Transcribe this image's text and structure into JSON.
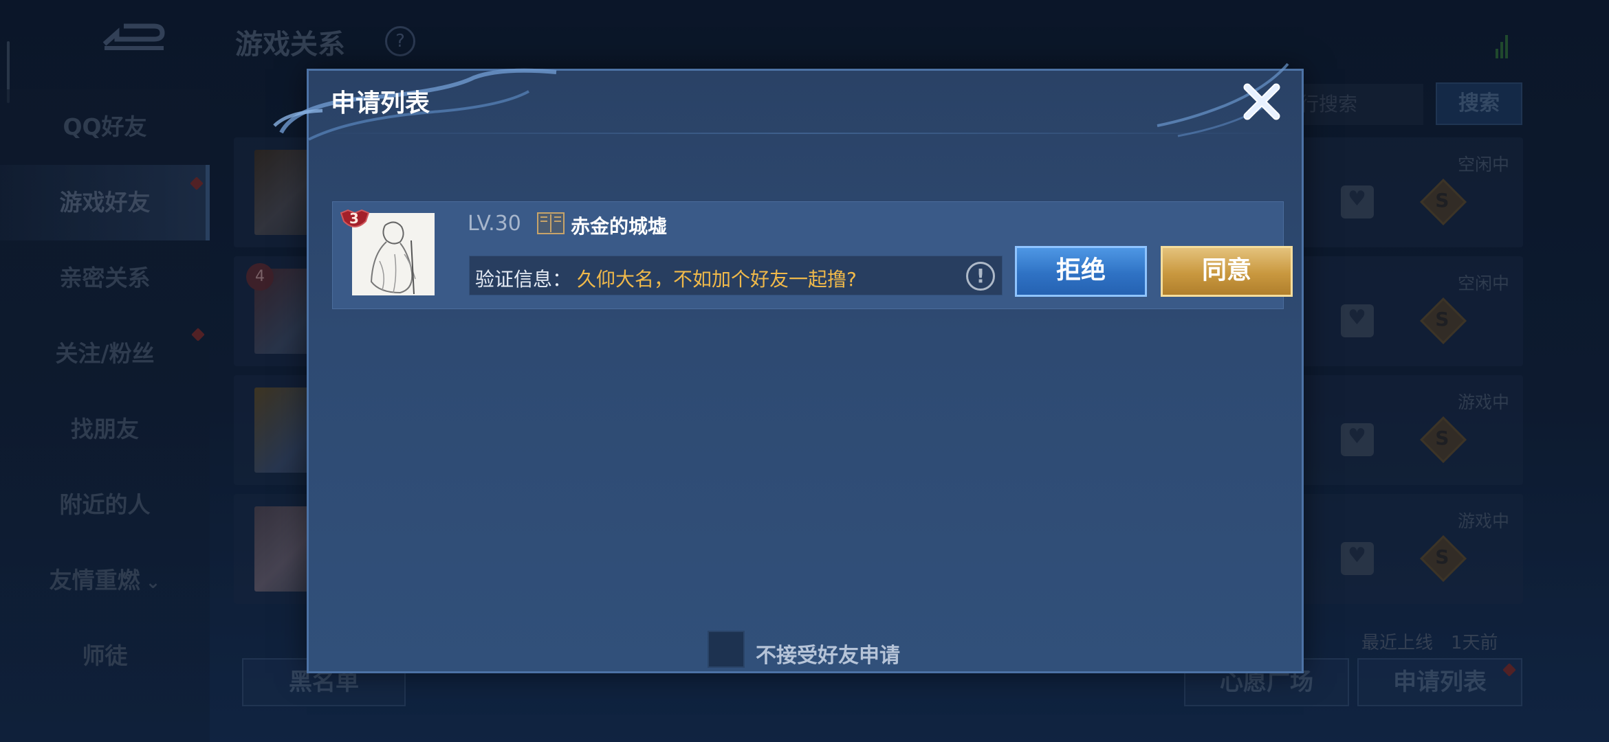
{
  "background": {
    "title": "游戏关系",
    "help_glyph": "?",
    "sidebar": {
      "items": [
        {
          "label": "QQ好友"
        },
        {
          "label": "游戏好友"
        },
        {
          "label": "亲密关系"
        },
        {
          "label": "关注/粉丝"
        },
        {
          "label": "找朋友"
        },
        {
          "label": "附近的人"
        },
        {
          "label": "友情重燃"
        },
        {
          "label": "师徒"
        }
      ],
      "expand_glyph": "⌄"
    },
    "search": {
      "placeholder_partial": "行搜索",
      "button_label": "搜索"
    },
    "friend_rows": [
      {
        "status": "空闲中",
        "level": ""
      },
      {
        "status": "空闲中",
        "level": "4"
      },
      {
        "status": "游戏中",
        "level": ""
      },
      {
        "status": "游戏中",
        "level": ""
      }
    ],
    "diamond_glyph": "S",
    "last_online": "最近上线　1天前",
    "bottom_buttons": {
      "blacklist": "黑名单",
      "wish_square": "心愿广场",
      "request_list": "申请列表"
    }
  },
  "dialog": {
    "title": "申请列表",
    "requests": [
      {
        "rank_badge": "3",
        "level": "LV.30",
        "name": "赤金的城墟",
        "verify_label": "验证信息：",
        "verify_message": "久仰大名，不如加个好友一起撸?",
        "info_glyph": "!",
        "reject_label": "拒绝",
        "accept_label": "同意"
      }
    ],
    "no_requests_checkbox_label": "不接受好友申请"
  },
  "colors": {
    "accent_blue": "#2f72c4",
    "accent_gold": "#c9983f",
    "message_yellow": "#f0b94a"
  }
}
